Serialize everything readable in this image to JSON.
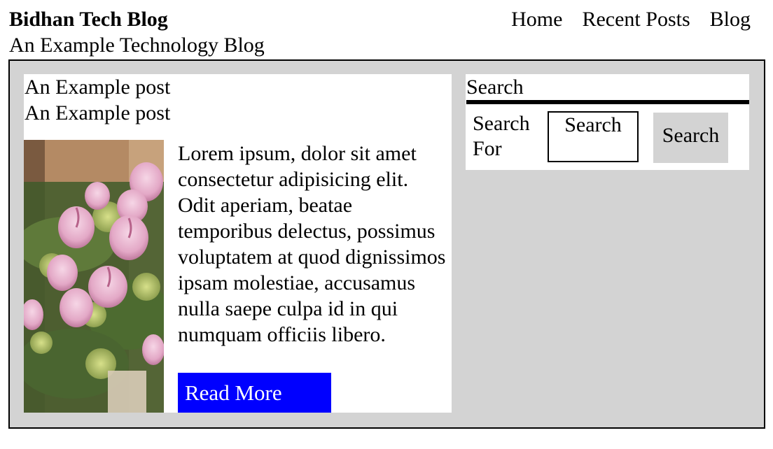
{
  "header": {
    "site_title": "Bidhan Tech Blog",
    "site_subtitle": "An Example Technology Blog",
    "nav": [
      {
        "label": "Home"
      },
      {
        "label": "Recent Posts"
      },
      {
        "label": "Blog"
      }
    ]
  },
  "post": {
    "title": "An Example post",
    "subtitle": "An Example post",
    "image_subject": "pink roses bouquet",
    "body": "Lorem ipsum, dolor sit amet consectetur adipisicing elit. Odit aperiam, beatae temporibus delectus, possimus voluptatem at quod dignissimos ipsam molestiae, accusamus nulla saepe culpa id in qui numquam officiis libero.",
    "read_more_label": "Read More",
    "read_more_color": "#0000ff"
  },
  "search": {
    "heading": "Search",
    "label": "Search For",
    "input_placeholder": "Search",
    "input_value": "",
    "button_label": "Search"
  },
  "colors": {
    "main_background": "#d3d3d3",
    "card_background": "#ffffff",
    "button_background": "#d3d3d3"
  }
}
